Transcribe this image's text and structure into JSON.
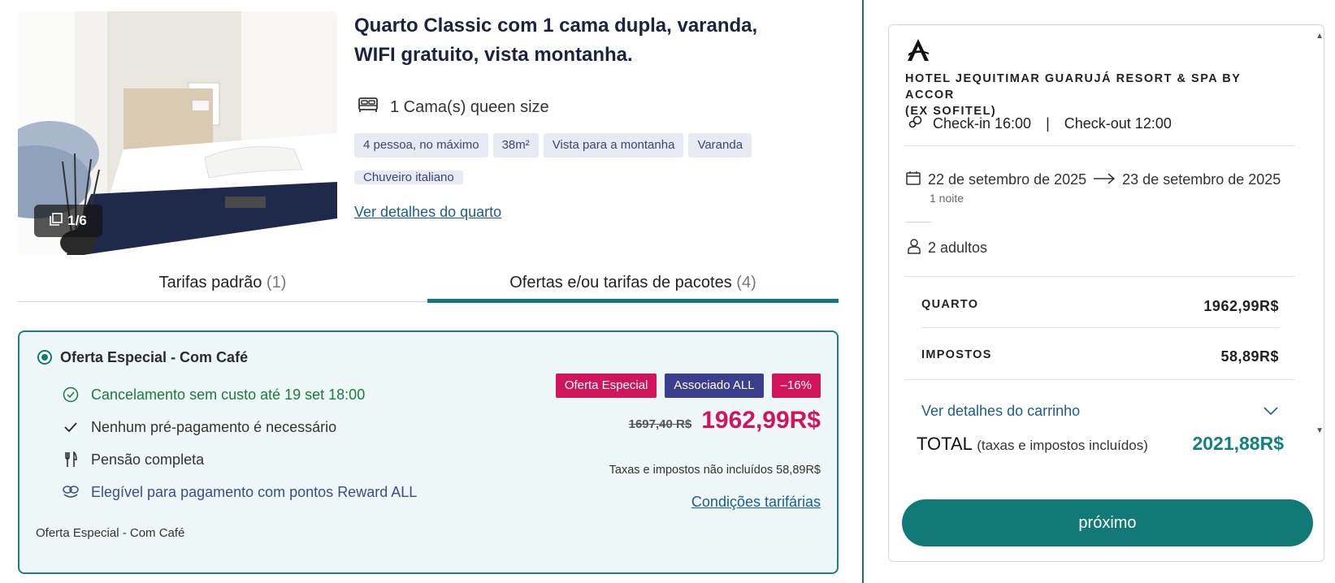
{
  "room": {
    "title": "Quarto Classic com 1 cama dupla, varanda, WIFI gratuito, vista montanha.",
    "photo_counter": "1/6",
    "bed": "1 Cama(s) queen size",
    "tags": [
      "4 pessoa, no máximo",
      "38m²",
      "Vista para a montanha",
      "Varanda"
    ],
    "tags_row2": [
      "Chuveiro italiano"
    ],
    "details_link": "Ver detalhes do quarto"
  },
  "tabs": [
    {
      "label": "Tarifas padrão",
      "count": "(1)"
    },
    {
      "label": "Ofertas e/ou tarifas de pacotes",
      "count": "(4)"
    }
  ],
  "offer": {
    "name": "Oferta Especial - Com Café",
    "cancellation": "Cancelamento sem custo até 19 set 18:00",
    "prepayment": "Nenhum pré-pagamento é necessário",
    "board": "Pensão completa",
    "reward": "Elegível para pagamento com pontos Reward ALL",
    "footer": "Oferta Especial - Com Café",
    "badges": [
      "Oferta Especial",
      "Associado ALL",
      "–16%"
    ],
    "old_price": "1697,40 R$",
    "new_price": "1962,99R$",
    "tax_note": "Taxas e impostos não incluídos 58,89R$",
    "conditions_link": "Condições tarifárias"
  },
  "summary": {
    "hotel_name_line1": "HOTEL JEQUITIMAR GUARUJÁ RESORT & SPA BY ACCOR",
    "hotel_name_line2": "(EX SOFITEL)",
    "checkin": "Check-in 16:00",
    "separator": "|",
    "checkout": "Check-out 12:00",
    "date_from": "22 de setembro de 2025",
    "date_to": "23 de setembro de 2025",
    "nights": "1 noite",
    "guests": "2 adultos",
    "room_label": "QUARTO",
    "room_amount": "1962,99R$",
    "tax_label": "IMPOSTOS",
    "tax_amount": "58,89R$",
    "cart_details": "Ver detalhes do carrinho",
    "total_label": "TOTAL",
    "total_note": "(taxas e impostos incluídos)",
    "total_amount": "2021,88R$",
    "next_button": "próximo"
  },
  "colors": {
    "accent": "#117a76",
    "price": "#d0155c",
    "member_badge": "#3a3e8c",
    "link": "#1b5e8c"
  }
}
